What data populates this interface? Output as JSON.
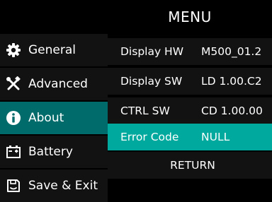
{
  "menu": {
    "title": "MENU"
  },
  "sidebar": {
    "items": [
      {
        "label": "General",
        "icon": "gear-icon"
      },
      {
        "label": "Advanced",
        "icon": "tools-icon"
      },
      {
        "label": "About",
        "icon": "info-icon",
        "selected": true
      },
      {
        "label": "Battery",
        "icon": "battery-icon"
      },
      {
        "label": "Save & Exit",
        "icon": "save-icon"
      }
    ]
  },
  "about": {
    "rows": [
      {
        "label": "Display HW",
        "value": "M500_01.2"
      },
      {
        "label": "Display SW",
        "value": "LD 1.00.C2"
      },
      {
        "label": "CTRL SW",
        "value": "CD 1.00.00"
      },
      {
        "label": "Error Code",
        "value": "NULL",
        "highlight": true
      }
    ],
    "return_label": "RETURN"
  },
  "colors": {
    "background": "#000000",
    "item_bg": "#121212",
    "selected_nav": "#006b6b",
    "highlight_row": "#00a99d",
    "text": "#ffffff"
  }
}
